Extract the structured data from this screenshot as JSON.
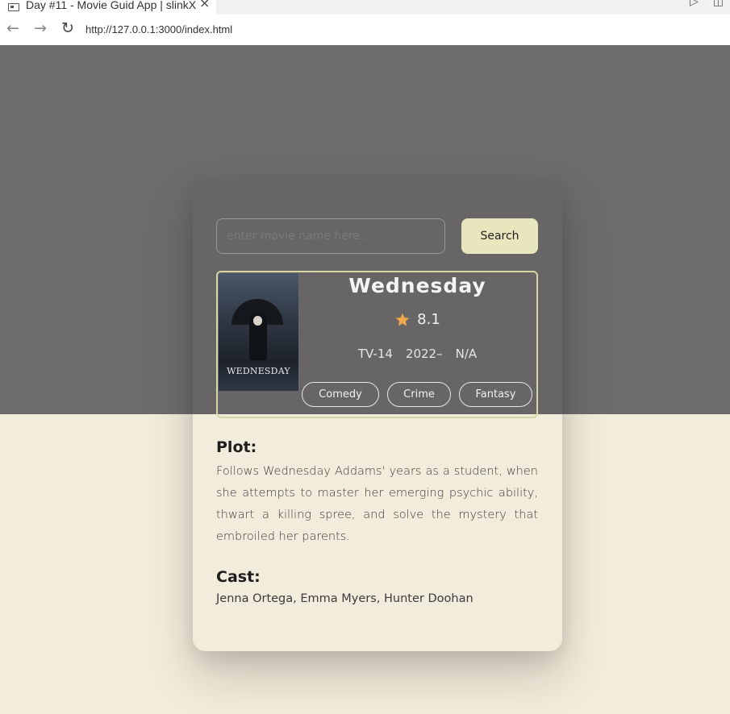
{
  "browser": {
    "tab_title": "Day #11 - Movie Guid App | slinkX",
    "tab_close": "×",
    "url": "http://127.0.0.1:3000/index.html",
    "back": "←",
    "forward": "→",
    "reload": "↻"
  },
  "search": {
    "placeholder": "enter movie name here...",
    "value": "",
    "button_label": "Search"
  },
  "movie": {
    "title": "Wednesday",
    "rating": "8.1",
    "rated": "TV-14",
    "year": "2022–",
    "runtime": "N/A",
    "genres": [
      "Comedy",
      "Crime",
      "Fantasy"
    ],
    "poster_title": "WEDNESDAY",
    "plot_heading": "Plot:",
    "plot": "Follows Wednesday Addams' years as a student, when she attempts to master her emerging psychic ability, thwart a killing spree, and solve the mystery that embroiled her parents.",
    "cast_heading": "Cast:",
    "cast": "Jenna Ortega, Emma Myers, Hunter Doohan"
  },
  "colors": {
    "top_band": "#6d6b6b",
    "page_bg": "#f2ecdc",
    "button_bg": "#e8e6bd",
    "star": "#f0a84b",
    "movie_border": "#d6d7a4"
  },
  "icons": {
    "star": "star-icon",
    "tab_favicon": "window-icon"
  }
}
